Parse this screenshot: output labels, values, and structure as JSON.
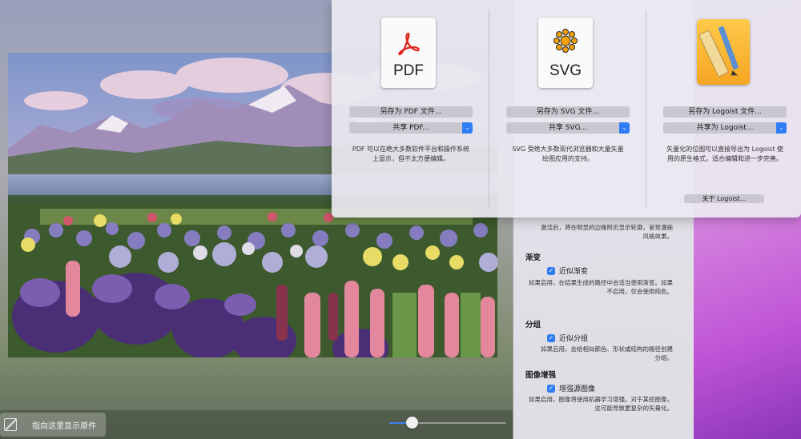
{
  "canvas": {
    "compare_label": "指向这里显示原件",
    "zoom_level": 0.19
  },
  "settings": {
    "edge_note_line1": "激活后，将在明显的边缘附近显示轮廓，呈现漫画",
    "edge_note_line2": "风格效果。",
    "gradient_title": "渐变",
    "gradient_checkbox": "近似渐变",
    "gradient_note_line1": "如果启用，在结果生成的路径中会适当使用渐变。如果",
    "gradient_note_line2": "不启用，仅会使用纯色。",
    "group_title": "分组",
    "group_checkbox": "近似分组",
    "group_note_line1": "如果启用，会给相似颜色、形状或结构的路径创建",
    "group_note_line2": "分组。",
    "enhance_title": "图像增强",
    "enhance_checkbox": "增强源图像",
    "enhance_note_line1": "如果启用，图像将使用机器学习增强。对于某些图像，",
    "enhance_note_line2": "这可能导致更复杂的矢量化。"
  },
  "export": {
    "pdf": {
      "ext": "PDF",
      "save_label": "另存为 PDF 文件...",
      "share_label": "共享 PDF...",
      "desc_line1": "PDF 可以在绝大多数软件平台和操作系统",
      "desc_line2": "上显示，但不太方便编辑。"
    },
    "svg": {
      "ext": "SVG",
      "save_label": "另存为 SVG 文件...",
      "share_label": "共享 SVG...",
      "desc_line1": "SVG 受绝大多数现代浏览器和大量矢量",
      "desc_line2": "绘图应用的支持。"
    },
    "logoist": {
      "save_label": "另存为 Logoist 文件...",
      "share_label": "共享为 Logoist...",
      "desc_line1": "矢量化的位图可以直接导出为 Logoist 使",
      "desc_line2": "用的原生格式，适合编辑和进一步完善。",
      "about_label": "关于 Logoist..."
    }
  },
  "colors": {
    "accent": "#2f7cf6",
    "pdf_red": "#e2231a",
    "svg_orange": "#f7a10a"
  }
}
